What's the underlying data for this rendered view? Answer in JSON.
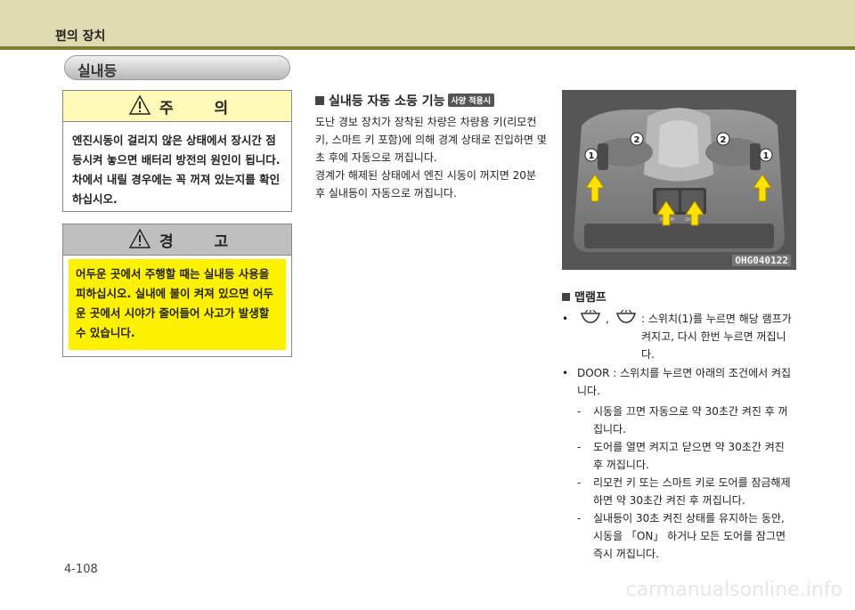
{
  "header": {
    "title": "편의 장치"
  },
  "section": {
    "title": "실내등"
  },
  "caution": {
    "title": "주 의",
    "text": "엔진시동이 걸리지 않은 상태에서 장시간 점등시켜 놓으면 배터리 방전의 원인이 됩니다. 차에서 내릴 경우에는 꼭 꺼져 있는지를 확인하십시오."
  },
  "warning": {
    "title": "경 고",
    "text": "어두운 곳에서 주행할 때는 실내등 사용을 피하십시오. 실내에 불이 켜져 있으면 어두운 곳에서 시야가 줄어들어 사고가 발생할 수 있습니다."
  },
  "auto_off": {
    "heading": "실내등 자동 소등 기능",
    "badge": "사양 적용시",
    "p1": "도난 경보 장치가 장착된 차량은 차량용 키(리모컨 키, 스마트 키 포함)에 의해 경계 상태로 진입하면 몇 초 후에 자동으로 꺼집니다.",
    "p2": "경계가 해제된 상태에서 엔진 시동이 꺼지면 20분 후 실내등이 자동으로 꺼집니다."
  },
  "photo": {
    "code": "OHG040122",
    "callout_1": "1",
    "callout_2": "2",
    "button_room": "ROOM",
    "button_door": "DOOR"
  },
  "map_lamp": {
    "heading": "맵램프",
    "bullet": "•",
    "comma": ",",
    "item1": ": 스위치(1)를 누르면 해당 램프가 켜지고, 다시 한번 누르면 꺼집니다.",
    "item2": "DOOR : 스위치를 누르면 아래의 조건에서 켜집니다.",
    "dash": "-",
    "sub1": "시동을 끄면 자동으로 약 30초간 켜진 후 꺼집니다.",
    "sub2": "도어를 열면 켜지고 닫으면 약 30초간 켜진 후 꺼집니다.",
    "sub3": "리모컨 키 또는 스마트 키로 도어를 잠금해제하면 약 30초간 켜진 후 꺼집니다.",
    "sub4": "실내등이 30초 켜진 상태를 유지하는 동안, 시동을 「ON」 하거나  모든 도어를 잠그면 즉시 꺼집니다."
  },
  "footer": {
    "page": "4-108",
    "watermark": "carmanualsonline.info"
  }
}
